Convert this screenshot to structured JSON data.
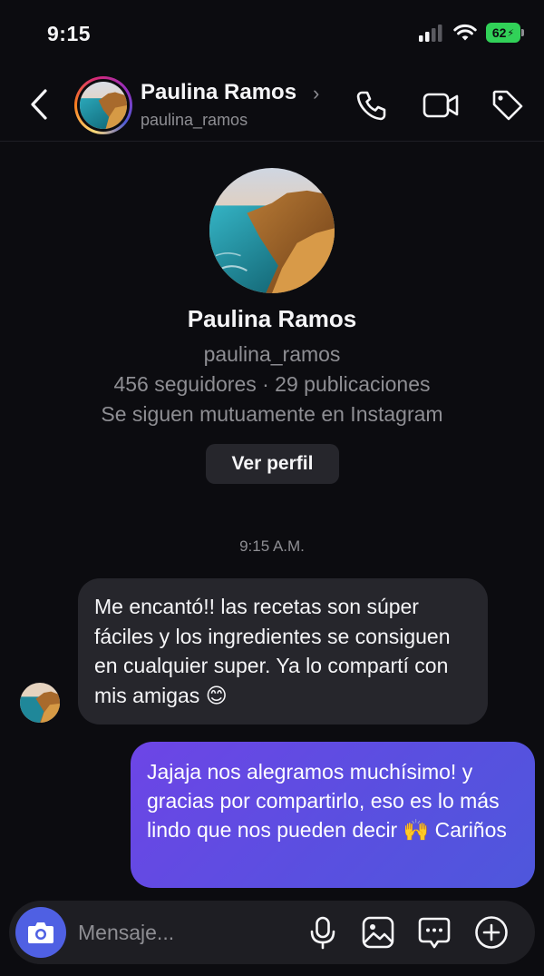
{
  "status": {
    "time": "9:15",
    "battery": "62"
  },
  "header": {
    "name": "Paulina Ramos",
    "chevron": "›",
    "username": "paulina_ramos",
    "icons": [
      "back-icon",
      "phone-icon",
      "video-icon",
      "tag-icon"
    ]
  },
  "profile": {
    "name": "Paulina Ramos",
    "username": "paulina_ramos",
    "stats": "456 seguidores · 29 publicaciones",
    "mutual": "Se siguen mutuamente en Instagram",
    "view_button": "Ver perfil"
  },
  "thread": {
    "timestamp": "9:15 A.M.",
    "messages": [
      {
        "direction": "incoming",
        "text": "Me encantó!! las recetas son súper fáciles y los ingredientes se consiguen en cualquier super. Ya lo compartí con mis amigas 😊"
      },
      {
        "direction": "outgoing",
        "text": "Jajaja nos alegramos muchísimo! y gracias por compartirlo, eso es lo más lindo que nos pueden decir 🙌 Cariños"
      }
    ]
  },
  "composer": {
    "placeholder": "Mensaje...",
    "icons": [
      "camera-icon",
      "microphone-icon",
      "gallery-icon",
      "sticker-icon",
      "plus-icon"
    ]
  },
  "colors": {
    "background": "#0c0c10",
    "incoming_bubble": "#26262c",
    "outgoing_bubble": "#5a4fe0",
    "camera_button": "#4f60e3",
    "battery": "#31d158"
  }
}
